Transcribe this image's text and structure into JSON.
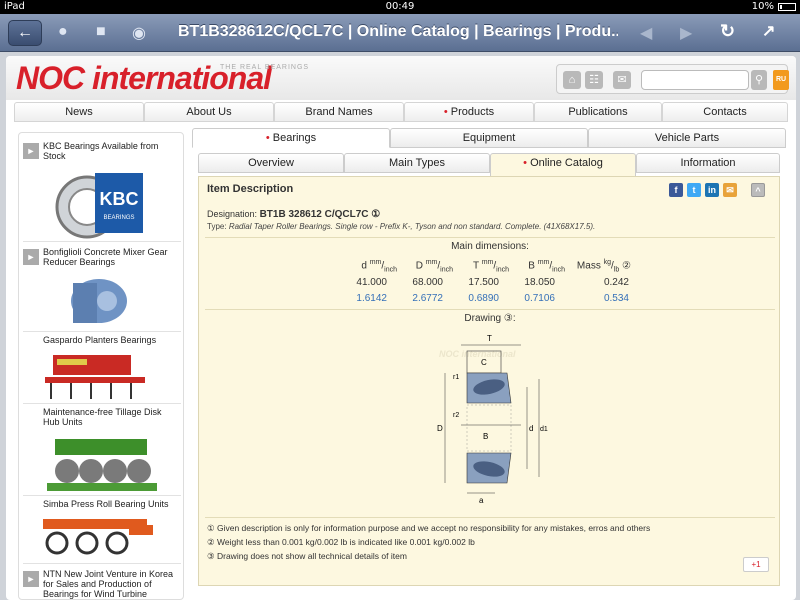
{
  "status_bar": {
    "device": "iPad",
    "time": "00:49",
    "battery": "10%"
  },
  "browser": {
    "title": "BT1B328612C/QCL7C | Online Catalog | Bearings | Produ..."
  },
  "site": {
    "logo": "NOC international",
    "tagline": "THE REAL BEARINGS",
    "lang": "RU",
    "search_placeholder": "",
    "nav": [
      "News",
      "About Us",
      "Brand Names",
      "Products",
      "Publications",
      "Contacts"
    ],
    "active_nav_index": 3
  },
  "sidebar": {
    "items": [
      {
        "title": "KBC Bearings Available from Stock"
      },
      {
        "title": "Bonfiglioli Concrete Mixer Gear Reducer Bearings"
      },
      {
        "title": "Gaspardo Planters Bearings"
      },
      {
        "title": "Maintenance-free Tillage Disk Hub Units"
      },
      {
        "title": "Simba Press Roll Bearing Units"
      },
      {
        "title": "NTN New Joint Venture in Korea for Sales and Production of Bearings for Wind Turbine"
      }
    ],
    "kbc_logo_text": "KBC",
    "kbc_sub": "BEARINGS"
  },
  "tabs_top": [
    "Bearings",
    "Equipment",
    "Vehicle Parts"
  ],
  "tabs_sub": [
    "Overview",
    "Main Types",
    "Online Catalog",
    "Information"
  ],
  "content": {
    "heading": "Item Description",
    "designation_label": "Designation:",
    "designation_value": "BT1B 328612 C/QCL7C ①",
    "type_label": "Type:",
    "type_value": "Radial Taper Roller Bearings. Single row - Prefix K-, Tyson and non standard. Complete. (41X68X17.5).",
    "main_dimensions_title": "Main dimensions:",
    "columns": [
      {
        "sym": "d",
        "unit_top": "mm",
        "unit_bot": "inch"
      },
      {
        "sym": "D",
        "unit_top": "mm",
        "unit_bot": "inch"
      },
      {
        "sym": "T",
        "unit_top": "mm",
        "unit_bot": "inch"
      },
      {
        "sym": "B",
        "unit_top": "mm",
        "unit_bot": "inch"
      },
      {
        "sym": "Mass",
        "unit_top": "kg",
        "unit_bot": "lb",
        "suffix": "②"
      }
    ],
    "row_mm": [
      "41.000",
      "68.000",
      "17.500",
      "18.050",
      "0.242"
    ],
    "row_inch": [
      "1.6142",
      "2.6772",
      "0.6890",
      "0.7106",
      "0.534"
    ],
    "drawing_title": "Drawing ③:",
    "drawing_labels": {
      "T": "T",
      "C": "C",
      "B": "B",
      "D": "D",
      "d": "d",
      "d1": "d1",
      "a": "a",
      "r1": "r1",
      "r2": "r2"
    },
    "watermark": "NOC international",
    "footnotes": [
      "① Given description is only for information purpose and we accept no responsibility for any mistakes, erros and others",
      "② Weight less than 0.001 kg/0.002 lb is indicated like 0.001 kg/0.002 lb",
      "③ Drawing does not show all technical details of item"
    ],
    "gplus_label": "+1"
  },
  "colors": {
    "brand_red": "#d8202a",
    "link_blue": "#3570b8",
    "panel_bg": "#fdf8e0"
  }
}
